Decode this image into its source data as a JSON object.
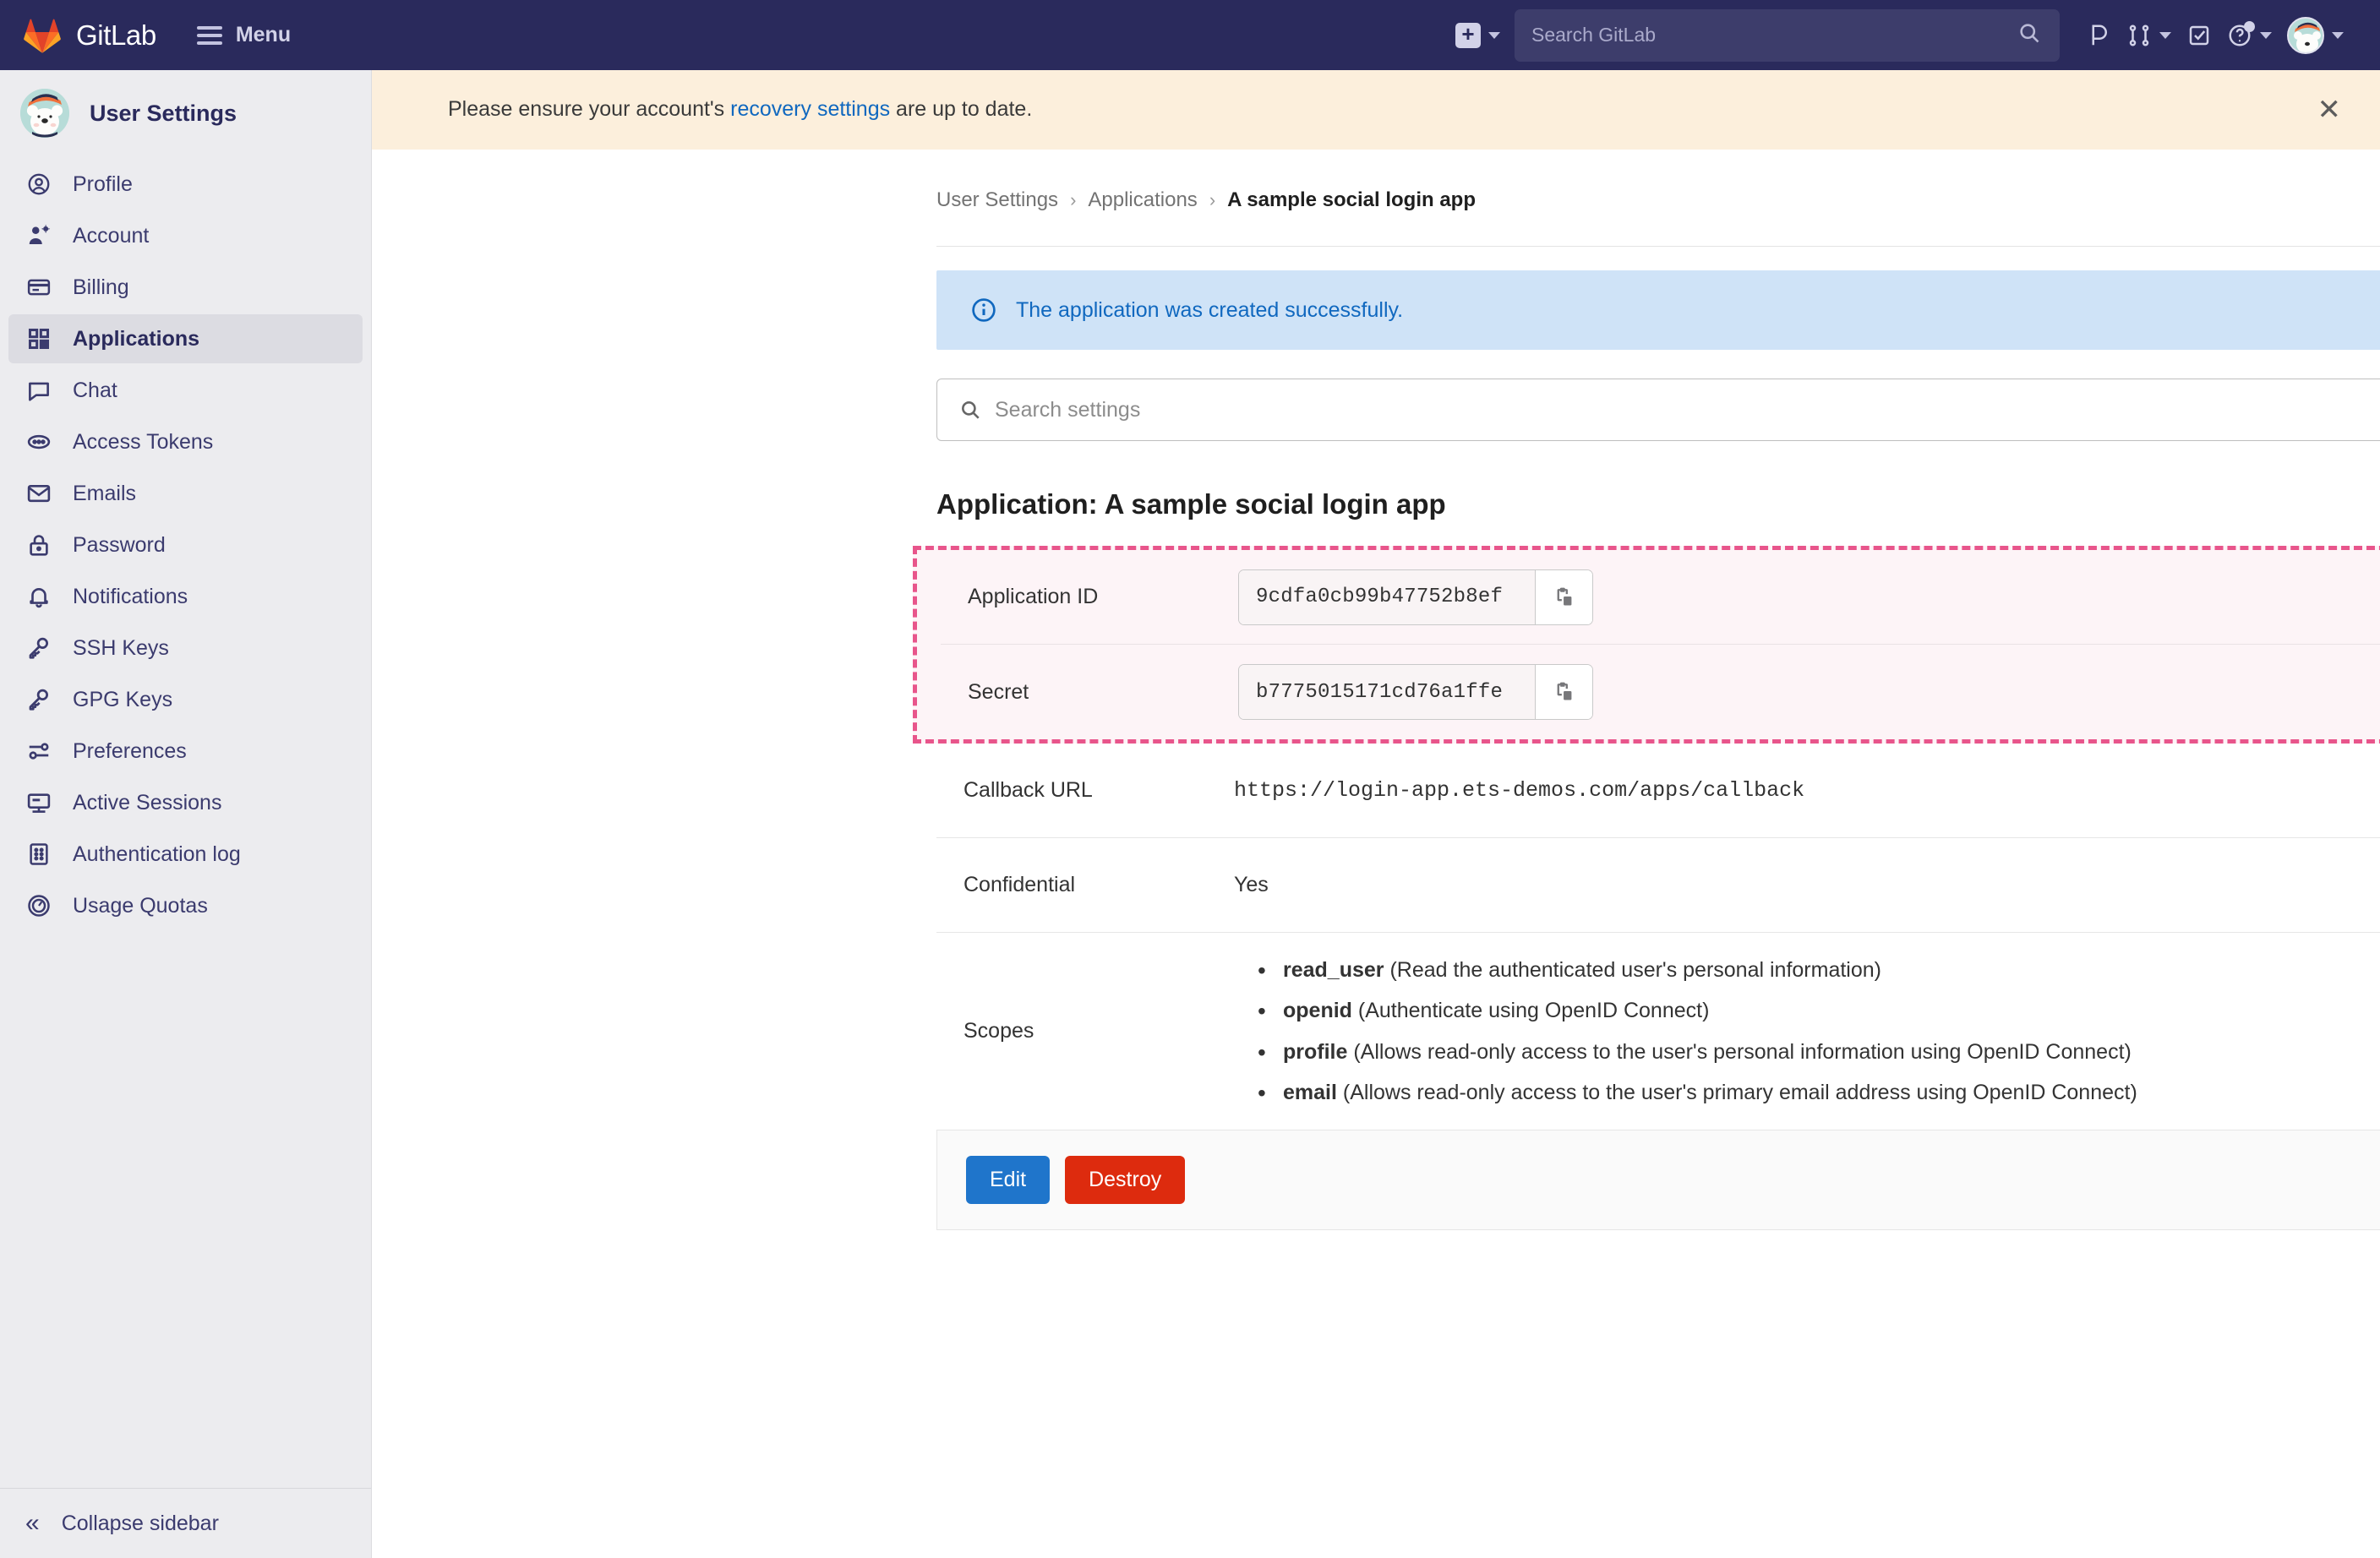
{
  "topbar": {
    "brand": "GitLab",
    "menu_label": "Menu",
    "create_icon": "plus-square-icon",
    "search_placeholder": "Search GitLab",
    "search_value": "",
    "search_icon": "search-icon",
    "issues_icon": "issues-icon",
    "merge_requests_icon": "merge-request-icon",
    "todos_icon": "todo-check-icon",
    "help_icon": "help-question-icon",
    "avatar_icon": "user-avatar",
    "bg_color": "#2a2a5c"
  },
  "sidebar": {
    "title": "User Settings",
    "avatar_icon": "polar-bear-avatar",
    "items": [
      {
        "label": "Profile",
        "icon": "profile-user-icon",
        "active": false
      },
      {
        "label": "Account",
        "icon": "account-gear-icon",
        "active": false
      },
      {
        "label": "Billing",
        "icon": "credit-card-icon",
        "active": false
      },
      {
        "label": "Applications",
        "icon": "applications-grid-icon",
        "active": true
      },
      {
        "label": "Chat",
        "icon": "chat-bubble-icon",
        "active": false
      },
      {
        "label": "Access Tokens",
        "icon": "token-icon",
        "active": false
      },
      {
        "label": "Emails",
        "icon": "envelope-icon",
        "active": false
      },
      {
        "label": "Password",
        "icon": "lock-icon",
        "active": false
      },
      {
        "label": "Notifications",
        "icon": "bell-icon",
        "active": false
      },
      {
        "label": "SSH Keys",
        "icon": "key-icon",
        "active": false
      },
      {
        "label": "GPG Keys",
        "icon": "key-icon",
        "active": false
      },
      {
        "label": "Preferences",
        "icon": "sliders-icon",
        "active": false
      },
      {
        "label": "Active Sessions",
        "icon": "monitor-icon",
        "active": false
      },
      {
        "label": "Authentication log",
        "icon": "log-list-icon",
        "active": false
      },
      {
        "label": "Usage Quotas",
        "icon": "gauge-icon",
        "active": false
      }
    ],
    "collapse_label": "Collapse sidebar",
    "collapse_icon": "chevron-double-left-icon"
  },
  "recovery_banner": {
    "text_before": "Please ensure your account's ",
    "link_text": "recovery settings",
    "text_after": " are up to date.",
    "close_icon": "close-icon",
    "bg_color": "#fcefdc"
  },
  "breadcrumb": {
    "items": [
      {
        "label": "User Settings",
        "current": false
      },
      {
        "label": "Applications",
        "current": false
      },
      {
        "label": "A sample social login app",
        "current": true
      }
    ],
    "separator": "›"
  },
  "success_alert": {
    "message": "The application was created successfully.",
    "icon": "info-circle-icon",
    "close_icon": "close-icon",
    "bg_color": "#cfe3f7",
    "text_color": "#1068bf"
  },
  "settings_search": {
    "placeholder": "Search settings",
    "value": "",
    "icon": "search-icon"
  },
  "application": {
    "heading": "Application: A sample social login app",
    "fields": [
      {
        "label": "Application ID",
        "value": "9cdfa0cb99b47752b8ef",
        "type": "token",
        "copy_icon": "copy-clipboard-icon",
        "highlighted": true
      },
      {
        "label": "Secret",
        "value": "b7775015171cd76a1ffe",
        "type": "token",
        "copy_icon": "copy-clipboard-icon",
        "highlighted": true
      },
      {
        "label": "Callback URL",
        "value": "https://login-app.ets-demos.com/apps/callback",
        "type": "mono",
        "highlighted": false
      },
      {
        "label": "Confidential",
        "value": "Yes",
        "type": "text",
        "highlighted": false
      }
    ],
    "scopes_label": "Scopes",
    "scopes": [
      {
        "name": "read_user",
        "description": "(Read the authenticated user's personal information)"
      },
      {
        "name": "openid",
        "description": "(Authenticate using OpenID Connect)"
      },
      {
        "name": "profile",
        "description": "(Allows read-only access to the user's personal information using OpenID Connect)"
      },
      {
        "name": "email",
        "description": "(Allows read-only access to the user's primary email address using OpenID Connect)"
      }
    ],
    "edit_label": "Edit",
    "destroy_label": "Destroy",
    "highlight_border_color": "#e8558b",
    "highlight_bg_color": "#fdf4f7"
  }
}
